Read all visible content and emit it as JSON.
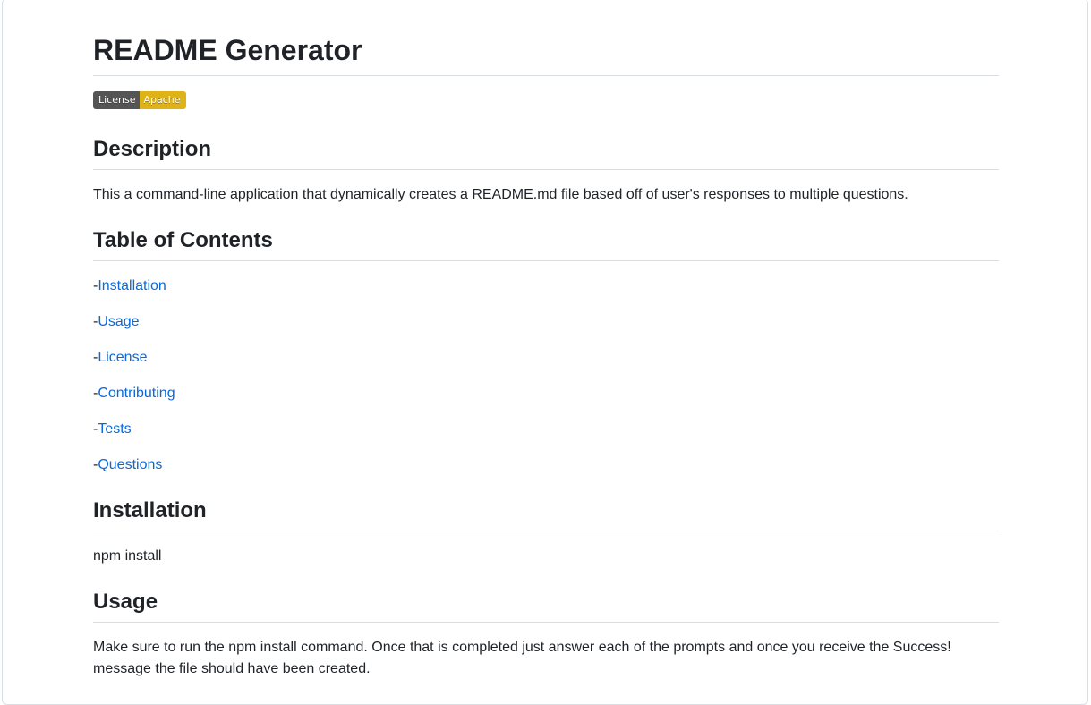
{
  "title": "README Generator",
  "badge": {
    "label": "License",
    "value": "Apache",
    "label_color": "#555555",
    "value_color": "#dfb317"
  },
  "description": {
    "heading": "Description",
    "text": "This a command-line application that dynamically creates a README.md file based off of user's responses to multiple questions."
  },
  "toc": {
    "heading": "Table of Contents",
    "prefix": "-",
    "items": [
      {
        "label": "Installation"
      },
      {
        "label": "Usage"
      },
      {
        "label": "License"
      },
      {
        "label": "Contributing"
      },
      {
        "label": "Tests"
      },
      {
        "label": "Questions"
      }
    ]
  },
  "installation": {
    "heading": "Installation",
    "text": "npm install"
  },
  "usage": {
    "heading": "Usage",
    "text": "Make sure to run the npm install command. Once that is completed just answer each of the prompts and once you receive the Success! message the file should have been created."
  },
  "colors": {
    "link": "#0969da",
    "text": "#1f2328",
    "divider": "#d8dee4"
  }
}
